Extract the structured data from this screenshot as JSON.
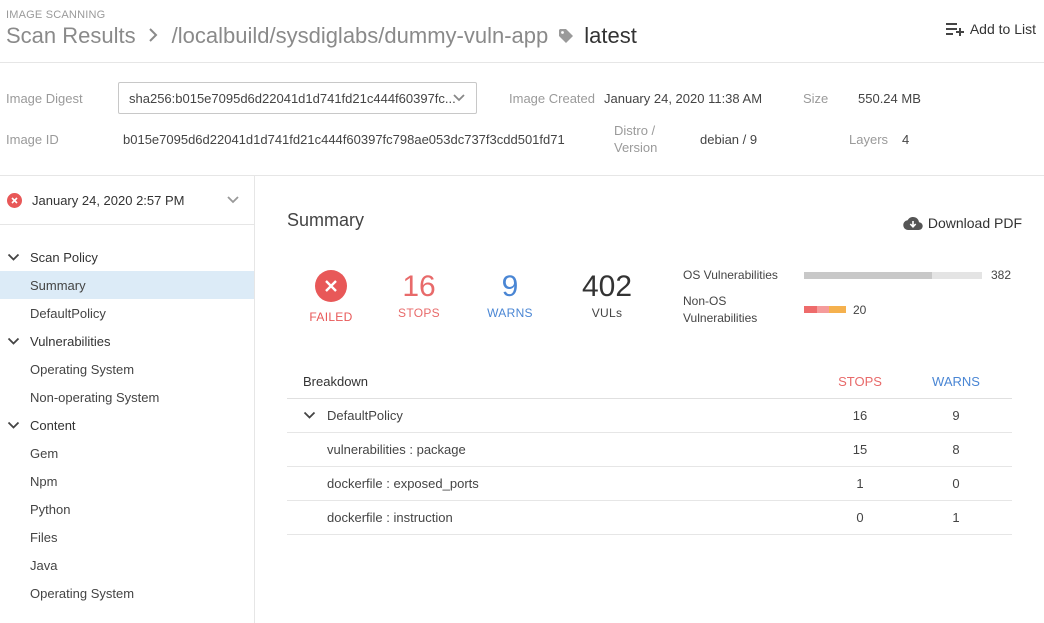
{
  "header": {
    "overline": "IMAGE SCANNING",
    "title": "Scan Results",
    "separator": ">",
    "path": "/localbuild/sysdiglabs/dummy-vuln-app",
    "tag": "latest",
    "add_to_list": "Add to List"
  },
  "meta": {
    "digest_label": "Image Digest",
    "digest_value": "sha256:b015e7095d6d22041d1d741fd21c444f60397fc...",
    "created_label": "Image Created",
    "created_value": "January 24, 2020 11:38 AM",
    "size_label": "Size",
    "size_value": "550.24 MB",
    "id_label": "Image ID",
    "id_value": "b015e7095d6d22041d1d741fd21c444f60397fc798ae053dc737f3cdd501fd71",
    "distro_label_1": "Distro /",
    "distro_label_2": "Version",
    "distro_value": "debian / 9",
    "layers_label": "Layers",
    "layers_value": "4"
  },
  "sidebar": {
    "scan_date": "January 24, 2020 2:57 PM",
    "groups": [
      {
        "label": "Scan Policy",
        "items": [
          "Summary",
          "DefaultPolicy"
        ]
      },
      {
        "label": "Vulnerabilities",
        "items": [
          "Operating System",
          "Non-operating System"
        ]
      },
      {
        "label": "Content",
        "items": [
          "Gem",
          "Npm",
          "Python",
          "Files",
          "Java",
          "Operating System"
        ]
      }
    ],
    "active_item": "Summary"
  },
  "summary": {
    "title": "Summary",
    "download_pdf": "Download PDF",
    "failed_label": "FAILED",
    "stops_value": "16",
    "stops_label": "STOPS",
    "warns_value": "9",
    "warns_label": "WARNS",
    "vulns_value": "402",
    "vulns_label": "VULs",
    "os_vuln_label": "OS Vulnerabilities",
    "os_vuln_count": "382",
    "os_vuln_fill_fraction": 0.72,
    "non_os_label_1": "Non-OS",
    "non_os_label_2": "Vulnerabilities",
    "non_os_count": "20"
  },
  "breakdown": {
    "header": {
      "name": "Breakdown",
      "stops": "STOPS",
      "warns": "WARNS"
    },
    "policy": {
      "name": "DefaultPolicy",
      "stops": "16",
      "warns": "9"
    },
    "rows": [
      {
        "name": "vulnerabilities : package",
        "stops": "15",
        "warns": "8"
      },
      {
        "name": "dockerfile : exposed_ports",
        "stops": "1",
        "warns": "0"
      },
      {
        "name": "dockerfile : instruction",
        "stops": "0",
        "warns": "1"
      }
    ]
  },
  "colors": {
    "fail_red": "#e85858",
    "stops_red": "#e86a6a",
    "warns_blue": "#4a86d4",
    "seg_red": "#ee6b6b",
    "seg_pink": "#f59b9b",
    "seg_orange": "#f5b14e"
  }
}
